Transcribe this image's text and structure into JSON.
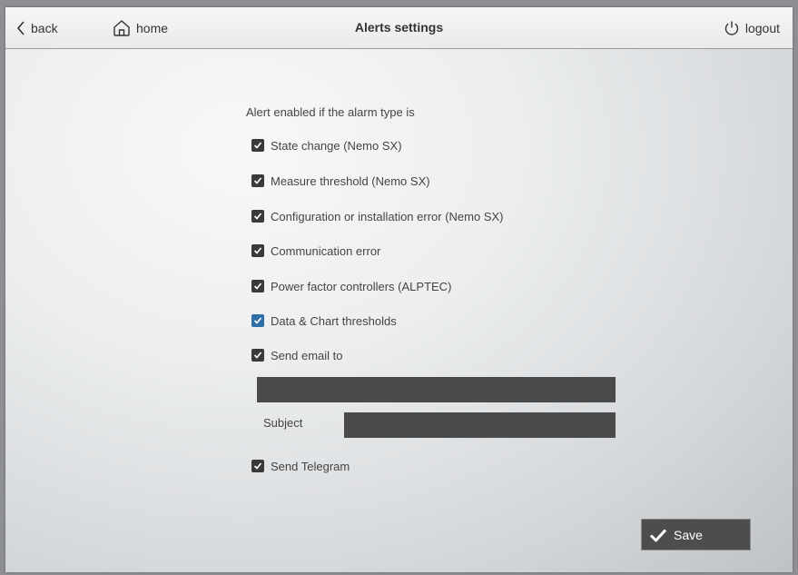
{
  "header": {
    "back_label": "back",
    "home_label": "home",
    "title": "Alerts settings",
    "logout_label": "logout"
  },
  "form": {
    "intro": "Alert enabled if the alarm type is",
    "options": [
      {
        "label": "State change (Nemo SX)",
        "checked": true
      },
      {
        "label": "Measure threshold (Nemo SX)",
        "checked": true
      },
      {
        "label": "Configuration or installation error (Nemo SX)",
        "checked": true
      },
      {
        "label": "Communication error",
        "checked": true
      },
      {
        "label": "Power factor controllers (ALPTEC)",
        "checked": true
      },
      {
        "label": "Data & Chart thresholds",
        "checked": true,
        "highlight": true
      },
      {
        "label": "Send email to",
        "checked": true
      }
    ],
    "email_value": "",
    "subject_label": "Subject",
    "subject_value": "",
    "telegram": {
      "label": "Send Telegram",
      "checked": true
    }
  },
  "footer": {
    "save_label": "Save"
  },
  "colors": {
    "checkbox": "#3a3a3a",
    "checkbox_highlight": "#2f6fa6",
    "input_bg": "#4a4a4a",
    "button_bg": "#4d4d4d"
  },
  "icons": [
    "chevron-left-icon",
    "home-icon",
    "power-icon",
    "checkmark-icon"
  ]
}
